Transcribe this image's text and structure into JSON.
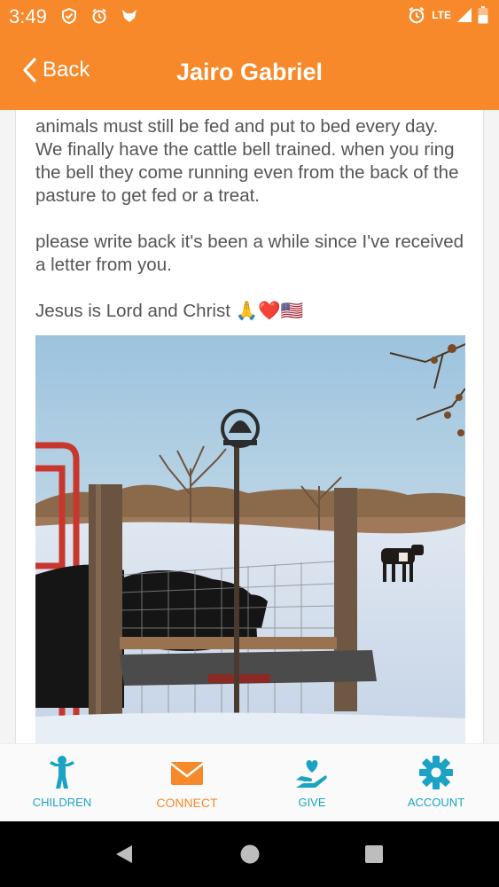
{
  "status_bar": {
    "time": "3:49",
    "network": "LTE",
    "icons": [
      "shield-check-icon",
      "alarm-icon",
      "fox-icon",
      "alarm-icon",
      "signal-icon",
      "battery-icon"
    ]
  },
  "header": {
    "back_label": "Back",
    "title": "Jairo Gabriel",
    "color": "#f7892a"
  },
  "letter": {
    "paragraphs": [
      "animals must still be fed and put to bed every day. We finally have the cattle bell trained. when you ring the bell they come running even from the back of the pasture to get fed or a treat.",
      "please write back it's been a while since I've received a letter from you.",
      "Jesus is Lord and Christ 🙏❤️🇺🇸"
    ],
    "photo_icon": "photo-cattle-bell-snow"
  },
  "nav": {
    "items": [
      {
        "label": "CHILDREN",
        "icon": "child-icon"
      },
      {
        "label": "CONNECT",
        "icon": "envelope-icon",
        "active": true
      },
      {
        "label": "GIVE",
        "icon": "hand-heart-icon"
      },
      {
        "label": "ACCOUNT",
        "icon": "gear-icon"
      }
    ],
    "active_color": "#f7892a",
    "inactive_color": "#1aa3c4"
  },
  "system_nav": {
    "buttons": [
      "back-triangle-icon",
      "home-circle-icon",
      "recents-square-icon"
    ]
  }
}
